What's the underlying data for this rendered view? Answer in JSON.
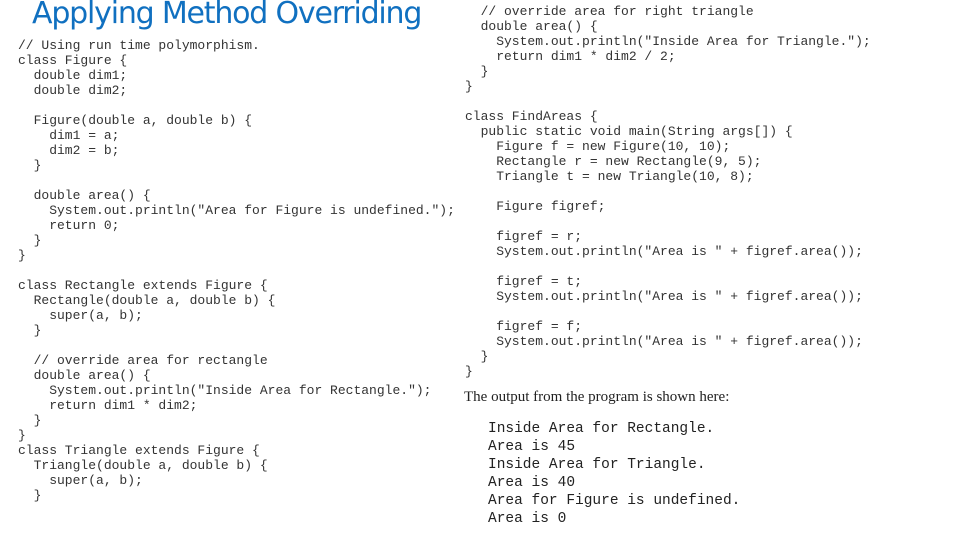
{
  "slide": {
    "title": "Applying Method Overriding",
    "title_color": "#1070c0"
  },
  "code_left": [
    "// Using run time polymorphism.",
    "class Figure {",
    "  double dim1;",
    "  double dim2;",
    "",
    "  Figure(double a, double b) {",
    "    dim1 = a;",
    "    dim2 = b;",
    "  }",
    "",
    "  double area() {",
    "    System.out.println(\"Area for Figure is undefined.\");",
    "    return 0;",
    "  }",
    "}",
    "",
    "class Rectangle extends Figure {",
    "  Rectangle(double a, double b) {",
    "    super(a, b);",
    "  }",
    "",
    "  // override area for rectangle",
    "  double area() {",
    "    System.out.println(\"Inside Area for Rectangle.\");",
    "    return dim1 * dim2;",
    "  }",
    "}",
    "class Triangle extends Figure {",
    "  Triangle(double a, double b) {",
    "    super(a, b);",
    "  }"
  ],
  "code_right": [
    "  // override area for right triangle",
    "  double area() {",
    "    System.out.println(\"Inside Area for Triangle.\");",
    "    return dim1 * dim2 / 2;",
    "  }",
    "}",
    "",
    "class FindAreas {",
    "  public static void main(String args[]) {",
    "    Figure f = new Figure(10, 10);",
    "    Rectangle r = new Rectangle(9, 5);",
    "    Triangle t = new Triangle(10, 8);",
    "",
    "    Figure figref;",
    "",
    "    figref = r;",
    "    System.out.println(\"Area is \" + figref.area());",
    "",
    "    figref = t;",
    "    System.out.println(\"Area is \" + figref.area());",
    "",
    "    figref = f;",
    "    System.out.println(\"Area is \" + figref.area());",
    "  }",
    "}"
  ],
  "output_caption": "The output from the program is shown here:",
  "program_output": [
    "Inside Area for Rectangle.",
    "Area is 45",
    "Inside Area for Triangle.",
    "Area is 40",
    "Area for Figure is undefined.",
    "Area is 0"
  ]
}
